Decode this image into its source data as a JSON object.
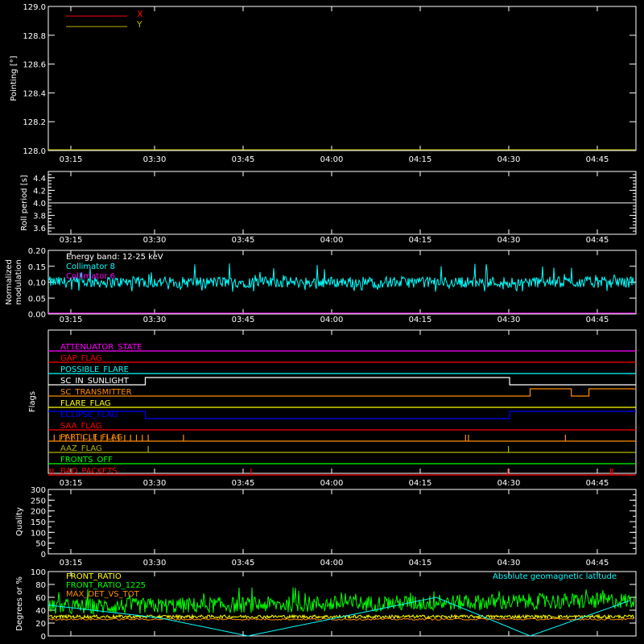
{
  "colors": {
    "background": "#000000",
    "axes": "#ffffff",
    "red": "#ff0000",
    "olive": "#b4b400",
    "cyan": "#00ffff",
    "magenta": "#ff00ff",
    "yellow": "#ffff00",
    "orange": "#ff8c00",
    "blue": "#0000ff",
    "green": "#00ff00",
    "white": "#ffffff"
  },
  "time_ticks": [
    "03:15",
    "03:30",
    "03:45",
    "04:00",
    "04:15",
    "04:30",
    "04:45"
  ],
  "chart_data": [
    {
      "id": "pointing",
      "type": "line",
      "ylabel": "Pointing [°]",
      "yticks": [
        "128.0",
        "128.2",
        "128.4",
        "128.6",
        "128.8",
        "129.0"
      ],
      "ylim": [
        128.0,
        129.0
      ],
      "legend_position": "top-left",
      "series": [
        {
          "name": "X",
          "color": "red",
          "values": []
        },
        {
          "name": "Y",
          "color": "olive",
          "values": [
            [
              0,
              128.0
            ],
            [
              100,
              128.0
            ]
          ]
        }
      ]
    },
    {
      "id": "roll",
      "type": "line",
      "ylabel": "Roll period [s]",
      "yticks": [
        "3.6",
        "3.8",
        "4.0",
        "4.2",
        "4.4"
      ],
      "ylim": [
        3.5,
        4.5
      ],
      "series": [
        {
          "color": "white",
          "values": [
            [
              0,
              4.0
            ],
            [
              100,
              4.0
            ]
          ]
        }
      ]
    },
    {
      "id": "modulation",
      "type": "line",
      "ylabel": "Normalized modulation",
      "yticks": [
        "0.00",
        "0.05",
        "0.10",
        "0.15",
        "0.20"
      ],
      "ylim": [
        0.0,
        0.2
      ],
      "annotations": [
        "Energy band: 12-25 keV"
      ],
      "series": [
        {
          "name": "Collimator 8",
          "color": "cyan",
          "approx_mean": 0.1,
          "approx_range": [
            0.07,
            0.16
          ]
        },
        {
          "name": "Collimator 6",
          "color": "magenta",
          "values": [
            [
              0,
              0.0
            ],
            [
              100,
              0.0
            ]
          ]
        }
      ]
    },
    {
      "id": "flags",
      "type": "line",
      "ylabel": "Flags",
      "flags": [
        {
          "name": "ATTENUATOR_STATE",
          "color": "magenta",
          "segments": [
            [
              0,
              100,
              0
            ]
          ]
        },
        {
          "name": "GAP_FLAG",
          "color": "red",
          "segments": [
            [
              0,
              100,
              0
            ]
          ]
        },
        {
          "name": "POSSIBLE_FLARE",
          "color": "cyan",
          "segments": [
            [
              0,
              100,
              0
            ]
          ]
        },
        {
          "name": "SC_IN_SUNLIGHT",
          "color": "white",
          "segments": [
            [
              0,
              16.5,
              0
            ],
            [
              16.5,
              78.5,
              1
            ],
            [
              78.5,
              100,
              0
            ]
          ]
        },
        {
          "name": "SC_TRANSMITTER",
          "color": "orange",
          "segments": [
            [
              0,
              82,
              0
            ],
            [
              82,
              89,
              1
            ],
            [
              89,
              92,
              0
            ],
            [
              92,
              100,
              1
            ]
          ]
        },
        {
          "name": "FLARE_FLAG",
          "color": "yellow",
          "segments": [
            [
              0,
              100,
              0
            ]
          ]
        },
        {
          "name": "ECLIPSE_FLAG",
          "color": "blue",
          "segments": [
            [
              0,
              16.5,
              1
            ],
            [
              16.5,
              78.5,
              0
            ],
            [
              78.5,
              100,
              1
            ]
          ]
        },
        {
          "name": "SAA_FLAG",
          "color": "red",
          "segments": [
            [
              0,
              100,
              0
            ]
          ]
        },
        {
          "name": "PARTICLE_FLAG",
          "color": "orange",
          "segments": [
            [
              0,
              100,
              0
            ]
          ],
          "spikes": [
            1,
            2,
            3,
            4,
            5,
            6,
            7,
            8,
            9,
            10,
            11,
            12,
            13,
            14,
            15,
            16,
            17,
            23,
            71,
            71.5,
            88
          ]
        },
        {
          "name": "AAZ_FLAG",
          "color": "olive",
          "segments": [
            [
              0,
              100,
              0
            ]
          ],
          "spikes": [
            17,
            78.3
          ]
        },
        {
          "name": "FRONTS_OFF",
          "color": "green",
          "segments": [
            [
              0,
              100,
              0
            ]
          ]
        },
        {
          "name": "BAD_PACKETS",
          "color": "red",
          "segments": [
            [
              0,
              100,
              0
            ]
          ],
          "spikes": [
            0.3,
            0.8,
            34.5,
            78.2,
            95.7,
            96
          ]
        }
      ]
    },
    {
      "id": "quality",
      "type": "line",
      "ylabel": "Quality",
      "yticks": [
        "0",
        "50",
        "100",
        "150",
        "200",
        "250",
        "300"
      ],
      "ylim": [
        0,
        300
      ],
      "series": []
    },
    {
      "id": "degrees",
      "type": "line",
      "ylabel": "Degrees or %",
      "yticks": [
        "0",
        "20",
        "40",
        "60",
        "80",
        "100"
      ],
      "ylim": [
        0,
        100
      ],
      "series": [
        {
          "name": "FRONT_RATIO",
          "color": "yellow",
          "approx_mean": 30
        },
        {
          "name": "FRONT_RATIO_1225",
          "color": "green",
          "approx_mean": 50,
          "approx_range": [
            30,
            75
          ]
        },
        {
          "name": "MAX_DET_VS_TOT",
          "color": "orange",
          "approx_mean": 26
        },
        {
          "name": "Absolute geomagnetic latitude",
          "color": "cyan",
          "values": [
            [
              0,
              48
            ],
            [
              19,
              28
            ],
            [
              34,
              0
            ],
            [
              49,
              28
            ],
            [
              66,
              60
            ],
            [
              82,
              0
            ],
            [
              99,
              55
            ]
          ]
        }
      ]
    }
  ]
}
